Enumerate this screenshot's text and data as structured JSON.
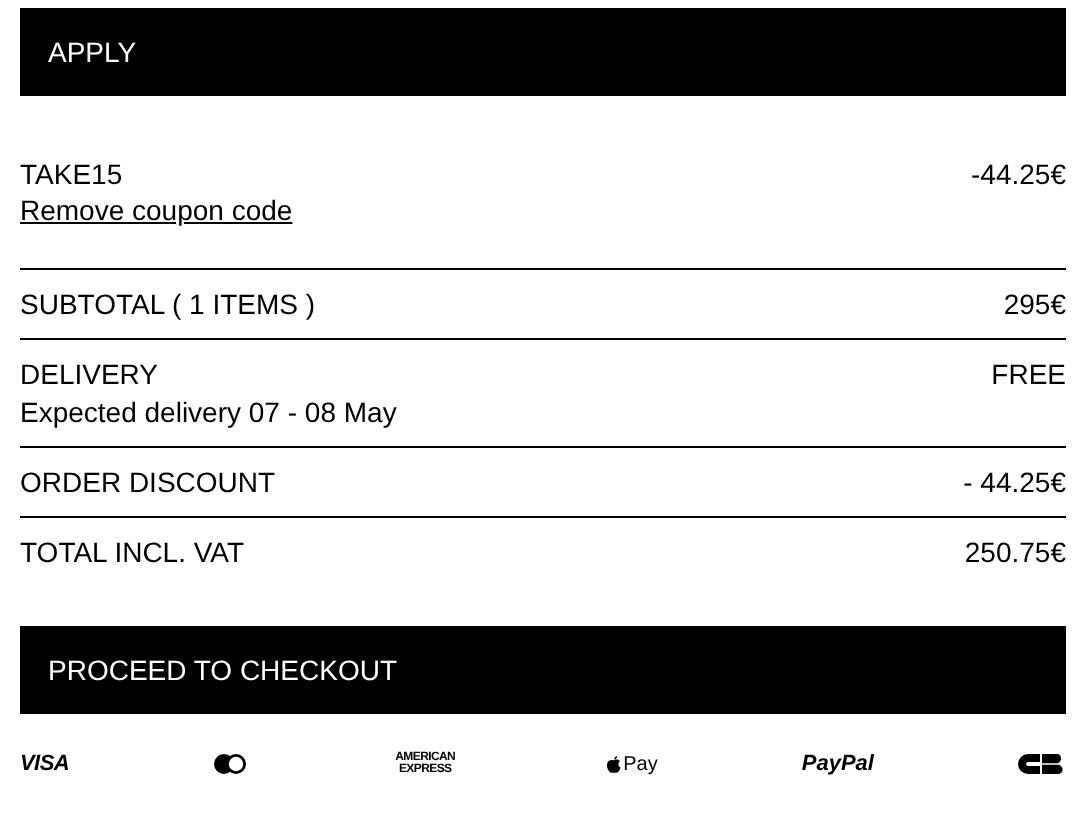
{
  "apply_button": "APPLY",
  "coupon": {
    "code": "TAKE15",
    "amount": "-44.25€",
    "remove_link": "Remove coupon code"
  },
  "summary_rows": [
    {
      "label": "SUBTOTAL ( 1 ITEMS )",
      "value": "295€"
    },
    {
      "label": "DELIVERY",
      "value": "FREE",
      "note": "Expected delivery 07 - 08 May"
    },
    {
      "label": "ORDER DISCOUNT",
      "value": "- 44.25€"
    },
    {
      "label": "TOTAL INCL. VAT",
      "value": "250.75€"
    }
  ],
  "checkout_button": "PROCEED TO CHECKOUT",
  "payment_methods": [
    {
      "kind": "visa",
      "text": "VISA"
    },
    {
      "kind": "mastercard"
    },
    {
      "kind": "amex",
      "text": "AMERICAN EXPRESS"
    },
    {
      "kind": "applepay",
      "text": "Pay"
    },
    {
      "kind": "paypal",
      "text": "PayPal"
    },
    {
      "kind": "cb"
    }
  ]
}
